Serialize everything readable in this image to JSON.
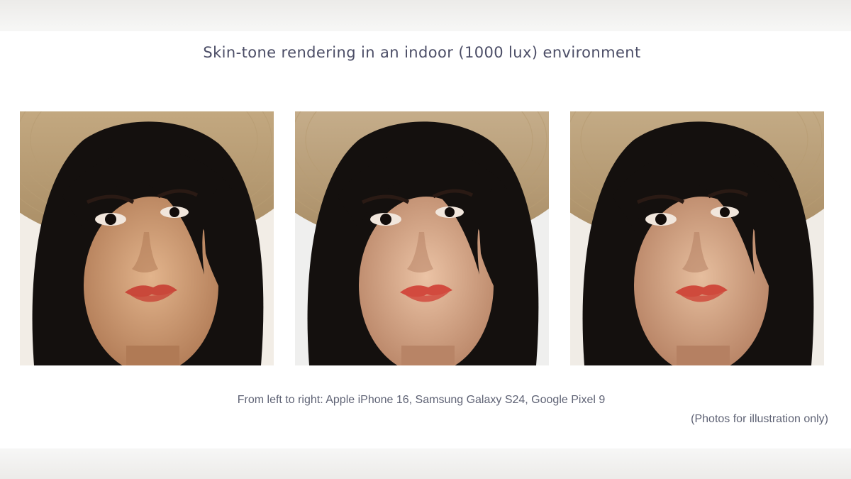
{
  "title": "Skin-tone rendering in an indoor (1000 lux) environment",
  "photos": [
    {
      "alt": "Apple iPhone 16",
      "skin": "#e2b48c",
      "shadow": "#b07a55",
      "lip": "#c9483a",
      "hat": "#d2b890",
      "bg": "#f2ede6"
    },
    {
      "alt": "Samsung Galaxy S24",
      "skin": "#ebc3a5",
      "shadow": "#b88466",
      "lip": "#d24a3e",
      "hat": "#d6c0a0",
      "bg": "#efefee"
    },
    {
      "alt": "Google Pixel 9",
      "skin": "#e6be9e",
      "shadow": "#b58062",
      "lip": "#cf4a3c",
      "hat": "#d3bc98",
      "bg": "#f0ece6"
    }
  ],
  "caption": "From left to right: Apple iPhone 16, Samsung Galaxy S24, Google Pixel 9",
  "note": "(Photos for illustration only)"
}
